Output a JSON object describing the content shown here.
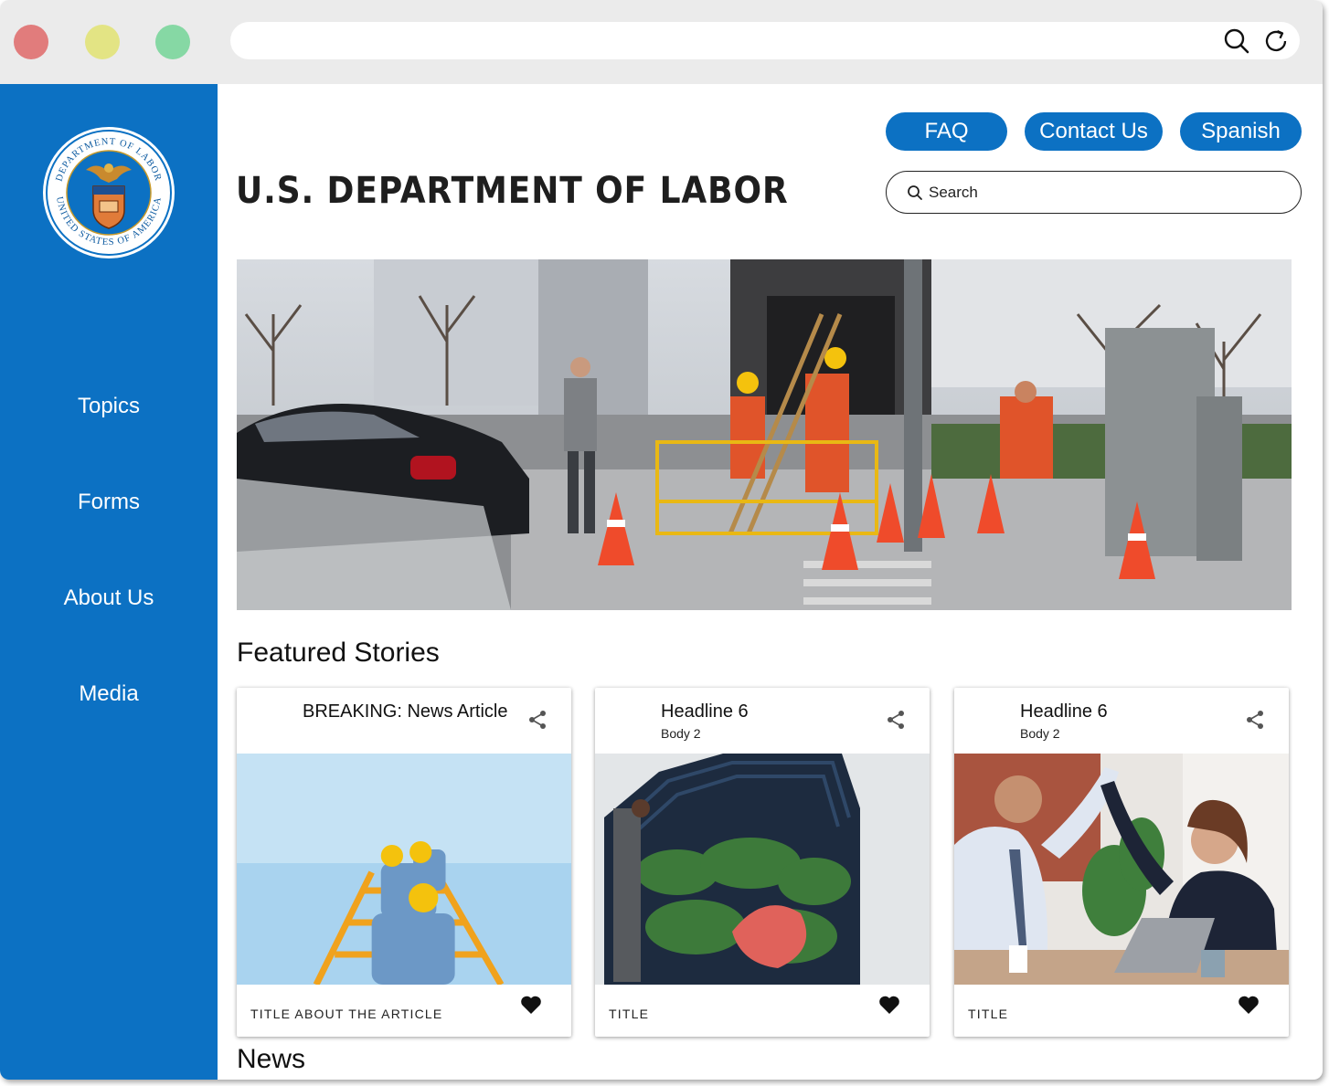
{
  "browser": {
    "url": "",
    "controls": {
      "close_color": "#e17c7c",
      "minimize_color": "#e3e484",
      "maximize_color": "#86d8a4"
    },
    "icons": [
      "search-icon",
      "reload-icon"
    ]
  },
  "sidebar": {
    "background": "#0c71c3",
    "seal": {
      "top_text": "DEPARTMENT OF LABOR",
      "bottom_text": "UNITED STATES OF AMERICA"
    },
    "items": [
      {
        "label": "Topics"
      },
      {
        "label": "Forms"
      },
      {
        "label": "About Us"
      },
      {
        "label": "Media"
      }
    ]
  },
  "header": {
    "site_title": "U.S. DEPARTMENT OF LABOR",
    "buttons": [
      {
        "label": "FAQ"
      },
      {
        "label": "Contact Us"
      },
      {
        "label": "Spanish"
      }
    ],
    "search": {
      "placeholder": "Search",
      "value": ""
    }
  },
  "featured": {
    "title": "Featured Stories",
    "cards": [
      {
        "headline": "BREAKING: News Article",
        "body": "",
        "footer_title": "TITLE ABOUT THE ARTICLE"
      },
      {
        "headline": "Headline 6",
        "body": "Body 2",
        "footer_title": "TITLE"
      },
      {
        "headline": "Headline 6",
        "body": "Body 2",
        "footer_title": "TITLE"
      }
    ]
  },
  "news": {
    "title": "News"
  },
  "colors": {
    "accent": "#0c71c3",
    "chrome": "#ebebeb"
  }
}
